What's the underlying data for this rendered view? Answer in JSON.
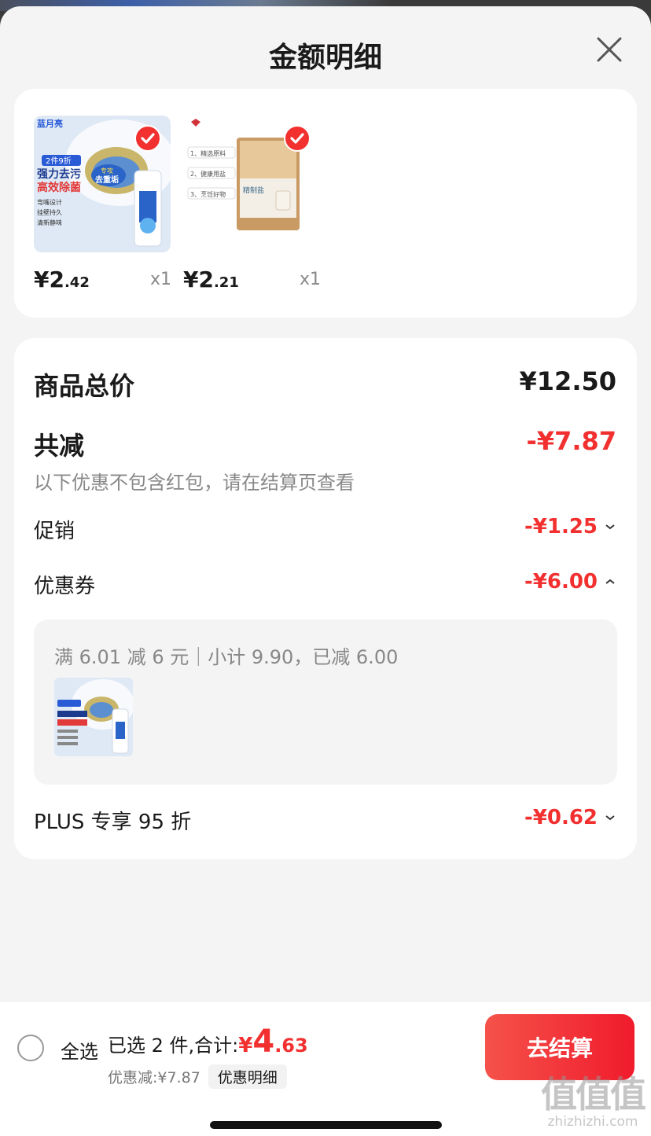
{
  "sheet": {
    "title": "金额明细"
  },
  "products": [
    {
      "name": "toilet-cleaner",
      "thumb_text": {
        "brand": "蓝月亮",
        "promo": "2件9折",
        "line1": "强力去污",
        "line2": "高效除菌",
        "badge1": "专攻",
        "badge2": "去重垢",
        "f1": "弯嘴设计",
        "f2": "挂壁持久",
        "f3": "清新静味"
      },
      "price_currency": "¥",
      "price_int": "2",
      "price_dec": ".42",
      "qty": "x1",
      "checked": true
    },
    {
      "name": "refined-salt",
      "thumb_text": {
        "f1": "1、精选原料",
        "f2": "2、健康用盐",
        "f3": "3、烹饪好物",
        "pack": "精制盐"
      },
      "price_currency": "¥",
      "price_int": "2",
      "price_dec": ".21",
      "qty": "x1",
      "checked": true
    }
  ],
  "summary": {
    "total_label": "商品总价",
    "total_value": "¥12.50",
    "reduce_label": "共减",
    "reduce_value": "-¥7.87",
    "reduce_note": "以下优惠不包含红包，请在结算页查看",
    "promo_label": "促销",
    "promo_value": "-¥1.25",
    "coupon_label": "优惠券",
    "coupon_value": "-¥6.00",
    "coupon_detail": "满 6.01 减 6 元｜小计 9.90，已减 6.00",
    "plus_label": "PLUS 专享 95 折",
    "plus_value": "-¥0.62"
  },
  "bottom": {
    "select_all": "全选",
    "selected_text": "已选 2 件,合计:",
    "total_currency": "¥",
    "total_int": "4",
    "total_dec": ".63",
    "discount_text": "优惠减:¥7.87",
    "detail_tag": "优惠明细",
    "checkout": "去结算"
  },
  "watermark": {
    "big": "值值值",
    "small": "zhizhizhi.com"
  },
  "colors": {
    "accent": "#f23030",
    "background": "#f4f4f4",
    "card": "#ffffff"
  }
}
